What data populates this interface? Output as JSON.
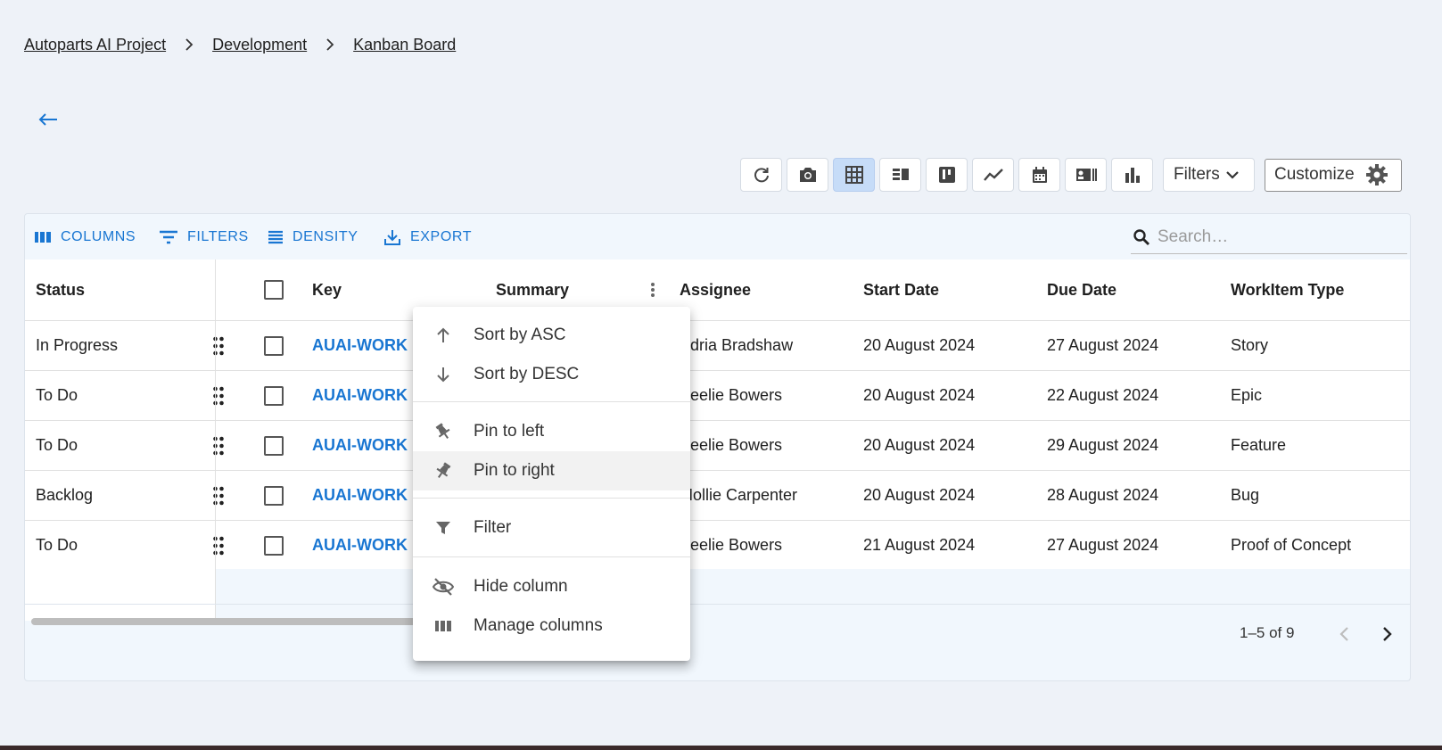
{
  "breadcrumb": [
    {
      "label": "Autoparts AI Project"
    },
    {
      "label": "Development"
    },
    {
      "label": "Kanban Board"
    }
  ],
  "toolbar": {
    "buttons": [
      "refresh-icon",
      "camera-icon",
      "grid-view-icon",
      "list-view-icon",
      "kanban-view-icon",
      "timeline-view-icon",
      "calendar-view-icon",
      "card-view-icon",
      "chart-view-icon"
    ],
    "active_button": "grid-view-icon",
    "filters_label": "Filters",
    "customize_label": "Customize"
  },
  "grid_toolbar": {
    "columns_label": "COLUMNS",
    "filters_label": "FILTERS",
    "density_label": "DENSITY",
    "export_label": "EXPORT",
    "search_placeholder": "Search…"
  },
  "columns": {
    "status": "Status",
    "key": "Key",
    "summary": "Summary",
    "assignee": "Assignee",
    "start_date": "Start Date",
    "due_date": "Due Date",
    "workitem_type": "WorkItem Type"
  },
  "rows": [
    {
      "status": "In Progress",
      "key": "AUAI-WORK",
      "assignee": "Adria Bradshaw",
      "start_date": "20 August 2024",
      "due_date": "27 August 2024",
      "type": "Story"
    },
    {
      "status": "To Do",
      "key": "AUAI-WORK",
      "assignee": "Keelie Bowers",
      "start_date": "20 August 2024",
      "due_date": "22 August 2024",
      "type": "Epic"
    },
    {
      "status": "To Do",
      "key": "AUAI-WORK",
      "assignee": "Keelie Bowers",
      "start_date": "20 August 2024",
      "due_date": "29 August 2024",
      "type": "Feature"
    },
    {
      "status": "Backlog",
      "key": "AUAI-WORK",
      "assignee": "Mollie Carpenter",
      "start_date": "20 August 2024",
      "due_date": "28 August 2024",
      "type": "Bug"
    },
    {
      "status": "To Do",
      "key": "AUAI-WORK",
      "assignee": "Keelie Bowers",
      "start_date": "21 August 2024",
      "due_date": "27 August 2024",
      "type": "Proof of Concept"
    }
  ],
  "pagination": {
    "label": "1–5 of 9"
  },
  "column_menu": {
    "sort_asc": "Sort by ASC",
    "sort_desc": "Sort by DESC",
    "pin_left": "Pin to left",
    "pin_right": "Pin to right",
    "filter": "Filter",
    "hide_column": "Hide column",
    "manage_columns": "Manage columns",
    "hovered_item": "Pin to right"
  },
  "colors": {
    "accent": "#1976d2",
    "page_bg": "#eef2f8",
    "grid_bg": "#f1f7fd",
    "active_toggle": "#c6dcf8"
  }
}
